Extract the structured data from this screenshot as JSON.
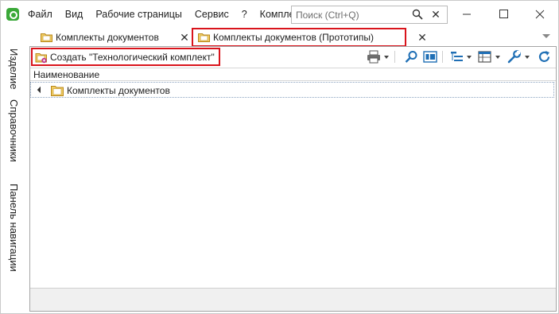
{
  "menu": {
    "items": [
      "Файл",
      "Вид",
      "Рабочие страницы",
      "Сервис",
      "?",
      "Комплек..."
    ]
  },
  "search": {
    "placeholder": "Поиск (Ctrl+Q)",
    "clear_glyph": "✕"
  },
  "window_controls": {
    "minimize": "minimize-icon",
    "maximize": "maximize-icon",
    "close": "close-icon"
  },
  "tabs": [
    {
      "label": "Комплекты документов",
      "active": false,
      "close_glyph": "✕"
    },
    {
      "label": "Комплекты документов (Прототипы)",
      "active": true,
      "close_glyph": "✕"
    }
  ],
  "sidenav": {
    "items": [
      "Изделие",
      "Справочники",
      "Панель навигации"
    ]
  },
  "toolbar": {
    "create_label": "Создать \"Технологический комплект\"",
    "icons": [
      "print-icon",
      "find-icon",
      "view-card-icon",
      "tree-view-icon",
      "columns-icon",
      "settings-wrench-icon",
      "refresh-icon"
    ]
  },
  "grid": {
    "column_header": "Наименование",
    "rows": [
      {
        "label": "Комплекты документов",
        "expanded": true
      }
    ]
  },
  "colors": {
    "highlight_border": "#d9141c",
    "folder": "#e8b93a",
    "accent_blue": "#1f6fb5",
    "app_logo": "#3aa838"
  }
}
